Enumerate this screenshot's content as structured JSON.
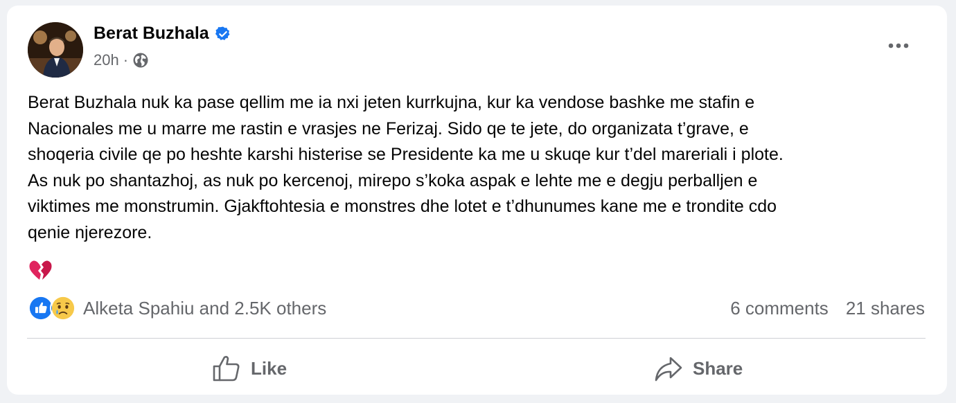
{
  "post": {
    "author": "Berat Buzhala",
    "time": "20h",
    "separator": "·",
    "text_lines": [
      "Berat Buzhala nuk ka pase qellim me ia nxi jeten kurrkujna, kur ka vendose bashke me stafin e",
      "Nacionales me u marre me rastin e vrasjes ne Ferizaj. Sido qe te jete, do organizata t’grave, e",
      "shoqeria civile qe po heshte karshi histerise se Presidente ka me u skuqe kur t’del mareriali i plote.",
      "As nuk po shantazhoj, as nuk po kercenoj, mirepo s’koka aspak e lehte me e degju perballjen e",
      "viktimes me monstrumin. Gjakftohtesia e monstres dhe lotet e t’dhunumes kane me e trondite cdo",
      "qenie njerezore."
    ]
  },
  "reactions": {
    "summary": "Alketa Spahiu and 2.5K others",
    "comments": "6 comments",
    "shares": "21 shares"
  },
  "actions": {
    "like_label": "Like",
    "share_label": "Share"
  },
  "icons": {
    "verified": "verified-badge-icon",
    "audience": "globe-icon",
    "more": "more-options-icon",
    "emoji": "broken-heart-icon",
    "reaction_like": "like-reaction-icon",
    "reaction_sad": "sad-reaction-icon",
    "like": "thumbs-up-icon",
    "share": "share-arrow-icon"
  },
  "colors": {
    "verified": "#1877f2",
    "secondary_text": "#65676b",
    "broken_heart": "#e0245e"
  }
}
